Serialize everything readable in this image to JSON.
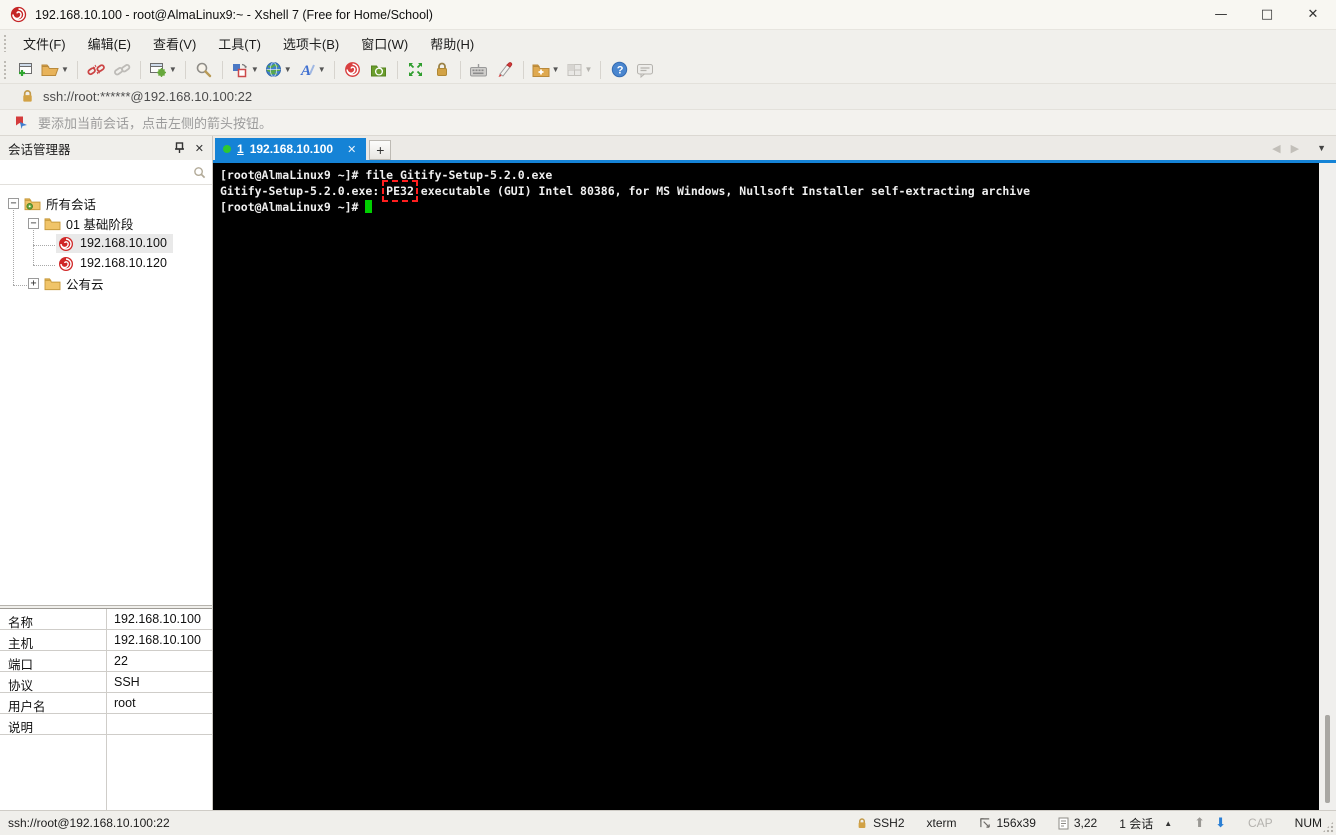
{
  "window": {
    "title": "192.168.10.100 - root@AlmaLinux9:~ - Xshell 7 (Free for Home/School)",
    "controls": {
      "minimize": "—",
      "maximize": "□",
      "close": "✕"
    }
  },
  "menu": {
    "items": [
      "文件(F)",
      "编辑(E)",
      "查看(V)",
      "工具(T)",
      "选项卡(B)",
      "窗口(W)",
      "帮助(H)"
    ]
  },
  "toolbar": {
    "icons": [
      "new-session",
      "open-session-folder",
      "disconnect",
      "reconnect",
      "session-properties",
      "find",
      "color-scheme",
      "web-browser",
      "font",
      "xshell-logo",
      "xftp-transfer",
      "fullscreen",
      "lock-screen",
      "virtual-keyboard",
      "highlighter",
      "new-session-folder",
      "tile-windows",
      "help",
      "feedback"
    ]
  },
  "address_bar": {
    "url": "ssh://root:******@192.168.10.100:22"
  },
  "info_bar": {
    "text": "要添加当前会话，点击左侧的箭头按钮。"
  },
  "session_manager": {
    "title": "会话管理器",
    "search_placeholder": "",
    "tree": [
      {
        "label": "所有会话",
        "expander": "-"
      },
      {
        "label": "01 基础阶段",
        "expander": "-"
      },
      {
        "label": "192.168.10.100",
        "selected": true
      },
      {
        "label": "192.168.10.120"
      },
      {
        "label": "公有云",
        "expander": "+"
      }
    ]
  },
  "properties": {
    "rows": [
      {
        "label": "名称",
        "value": "192.168.10.100"
      },
      {
        "label": "主机",
        "value": "192.168.10.100"
      },
      {
        "label": "端口",
        "value": "22"
      },
      {
        "label": "协议",
        "value": "SSH"
      },
      {
        "label": "用户名",
        "value": "root"
      },
      {
        "label": "说明",
        "value": ""
      }
    ]
  },
  "tabs": {
    "active": {
      "index": "1",
      "label": "192.168.10.100",
      "close": "✕"
    },
    "new_tab": "+"
  },
  "terminal": {
    "line1": "[root@AlmaLinux9 ~]# file Gitify-Setup-5.2.0.exe",
    "line2_prefix": "Gitify-Setup-5.2.0.exe: ",
    "line2_highlight": "PE32",
    "line2_suffix": " executable (GUI) Intel 80386, for MS Windows, Nullsoft Installer self-extracting archive",
    "line3_prompt": "[root@AlmaLinux9 ~]# "
  },
  "status_bar": {
    "left": "ssh://root@192.168.10.100:22",
    "encryption": "SSH2",
    "term_type": "xterm",
    "size": "156x39",
    "cursor_pos": "3,22",
    "sessions": "1 会话",
    "cap": "CAP",
    "num": "NUM"
  },
  "colors": {
    "accent_blue": "#1583d6",
    "terminal_green": "#00cf00",
    "annotation_red": "#ff1f1f",
    "tab_dot_green": "#2ec832",
    "lock_gold": "#d2a245"
  }
}
